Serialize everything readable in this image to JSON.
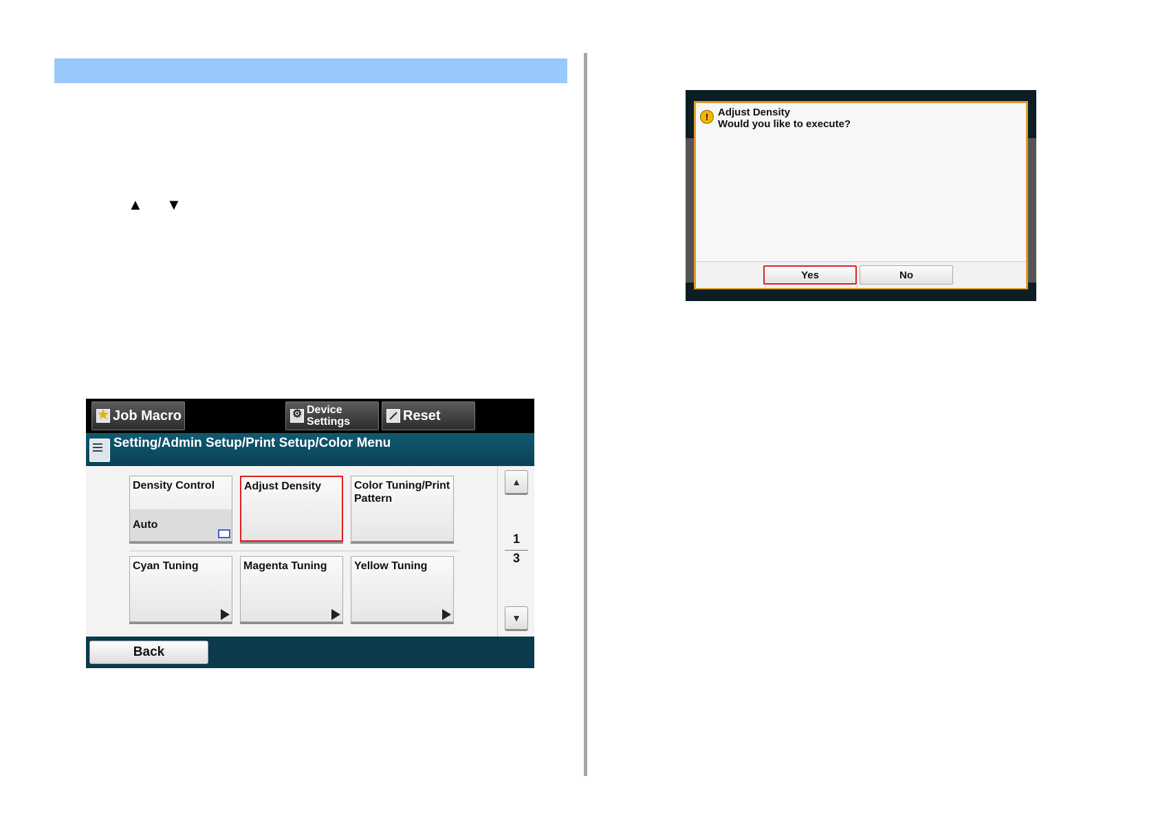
{
  "left_page": {
    "up_arrow": "▲",
    "down_arrow": "▼"
  },
  "panel": {
    "topbar": {
      "job_macro_label": "Job Macro",
      "device_settings_line1": "Device",
      "device_settings_line2": "Settings",
      "reset_label": "Reset"
    },
    "breadcrumb": "Setting/Admin Setup/Print Setup/Color Menu",
    "tiles": [
      {
        "label": "Density Control",
        "value": "Auto"
      },
      {
        "label": "Adjust Density",
        "value": ""
      },
      {
        "label": "Color Tuning/Print Pattern",
        "value": ""
      },
      {
        "label": "Cyan Tuning",
        "value": ""
      },
      {
        "label": "Magenta Tuning",
        "value": ""
      },
      {
        "label": "Yellow Tuning",
        "value": ""
      }
    ],
    "pager": {
      "up": "▲",
      "current": "1",
      "total": "3",
      "down": "▼"
    },
    "back_label": "Back"
  },
  "dialog": {
    "warn_glyph": "!",
    "title": "Adjust Density",
    "message": "Would you like to execute?",
    "yes_label": "Yes",
    "no_label": "No"
  },
  "colors": {
    "header_bar": "#99c9fb",
    "highlight_red": "#e01e1e",
    "dialog_border": "#e09a2a",
    "title_bar": "#0a4257"
  }
}
